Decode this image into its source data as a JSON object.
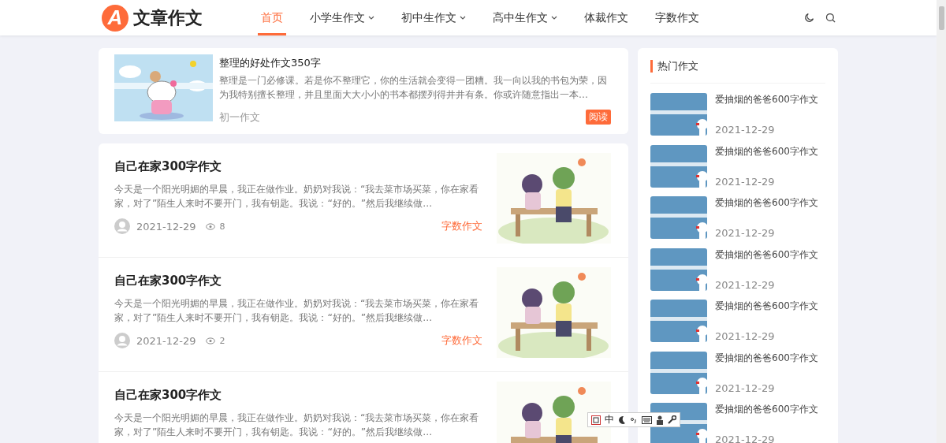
{
  "header": {
    "logo": {
      "mark": "A",
      "text": "文章作文"
    },
    "nav": [
      {
        "label": "首页",
        "selected": true,
        "has_menu": false
      },
      {
        "label": "小学生作文",
        "selected": false,
        "has_menu": true
      },
      {
        "label": "初中生作文",
        "selected": false,
        "has_menu": true
      },
      {
        "label": "高中生作文",
        "selected": false,
        "has_menu": true
      },
      {
        "label": "体裁作文",
        "selected": false,
        "has_menu": false
      },
      {
        "label": "字数作文",
        "selected": false,
        "has_menu": false
      }
    ]
  },
  "featured": {
    "title": "整理的好处作文350字",
    "excerpt": "整理是一门必修课。若是你不整理它，你的生活就会变得一团糟。我一向以我的书包为荣，因为我特别擅长整理，并且里面大大小小的书本都摆列得井井有条。你或许随意指出一本...",
    "category": "初一作文",
    "button": "阅读"
  },
  "articles": [
    {
      "title": "自己在家300字作文",
      "excerpt": "今天是一个阳光明媚的早晨，我正在做作业。奶奶对我说：“我去菜市场买菜，你在家看家，对了”陌生人来时不要开门，我有钥匙。我说：“好的。”然后我继续做...",
      "date": "2021-12-29",
      "views": "8",
      "category": "字数作文"
    },
    {
      "title": "自己在家300字作文",
      "excerpt": "今天是一个阳光明媚的早晨，我正在做作业。奶奶对我说：“我去菜市场买菜，你在家看家，对了”陌生人来时不要开门，我有钥匙。我说：“好的。”然后我继续做...",
      "date": "2021-12-29",
      "views": "2",
      "category": "字数作文"
    },
    {
      "title": "自己在家300字作文",
      "excerpt": "今天是一个阳光明媚的早晨，我正在做作业。奶奶对我说：“我去菜市场买菜，你在家看家，对了”陌生人来时不要开门，我有钥匙。我说：“好的。”然后我继续做..."
    }
  ],
  "sidebar": {
    "title": "热门作文",
    "items": [
      {
        "title": "爱抽烟的爸爸600字作文",
        "date": "2021-12-29"
      },
      {
        "title": "爱抽烟的爸爸600字作文",
        "date": "2021-12-29"
      },
      {
        "title": "爱抽烟的爸爸600字作文",
        "date": "2021-12-29"
      },
      {
        "title": "爱抽烟的爸爸600字作文",
        "date": "2021-12-29"
      },
      {
        "title": "爱抽烟的爸爸600字作文",
        "date": "2021-12-29"
      },
      {
        "title": "爱抽烟的爸爸600字作文",
        "date": "2021-12-29"
      },
      {
        "title": "爱抽烟的爸爸600字作文",
        "date": "2021-12-29"
      }
    ]
  },
  "ime_toolbar": {
    "mode": "中"
  }
}
